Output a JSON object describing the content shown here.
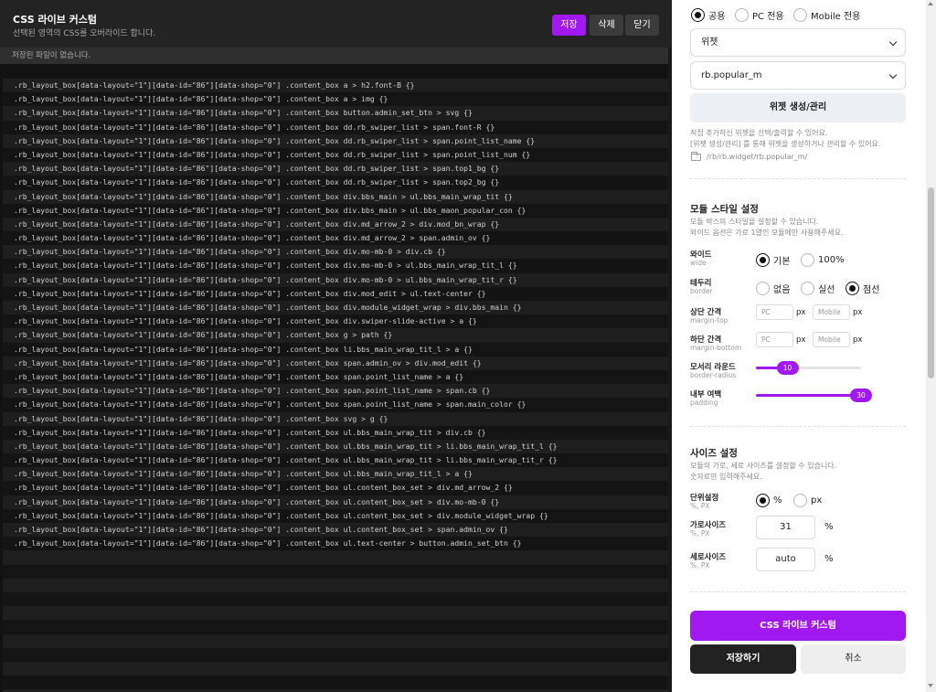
{
  "editor": {
    "title": "CSS 라이브 커스텀",
    "subtitle": "선택된 영역의 CSS를 오버라이드 합니다.",
    "buttons": {
      "save": "저장",
      "delete": "삭제",
      "close": "닫기"
    },
    "notice": "저장된 파일이 없습니다.",
    "lines": [
      ".rb_layout_box[data-layout=\"1\"][data-id=\"86\"][data-shop=\"0\"] .content_box a > h2.font-B {}",
      ".rb_layout_box[data-layout=\"1\"][data-id=\"86\"][data-shop=\"0\"] .content_box a > img {}",
      ".rb_layout_box[data-layout=\"1\"][data-id=\"86\"][data-shop=\"0\"] .content_box button.admin_set_btn > svg {}",
      ".rb_layout_box[data-layout=\"1\"][data-id=\"86\"][data-shop=\"0\"] .content_box dd.rb_swiper_list > span.font-R {}",
      ".rb_layout_box[data-layout=\"1\"][data-id=\"86\"][data-shop=\"0\"] .content_box dd.rb_swiper_list > span.point_list_name {}",
      ".rb_layout_box[data-layout=\"1\"][data-id=\"86\"][data-shop=\"0\"] .content_box dd.rb_swiper_list > span.point_list_num {}",
      ".rb_layout_box[data-layout=\"1\"][data-id=\"86\"][data-shop=\"0\"] .content_box dd.rb_swiper_list > span.top1_bg {}",
      ".rb_layout_box[data-layout=\"1\"][data-id=\"86\"][data-shop=\"0\"] .content_box dd.rb_swiper_list > span.top2_bg {}",
      ".rb_layout_box[data-layout=\"1\"][data-id=\"86\"][data-shop=\"0\"] .content_box div.bbs_main > ul.bbs_main_wrap_tit {}",
      ".rb_layout_box[data-layout=\"1\"][data-id=\"86\"][data-shop=\"0\"] .content_box div.bbs_main > ul.bbs_maon_popular_con {}",
      ".rb_layout_box[data-layout=\"1\"][data-id=\"86\"][data-shop=\"0\"] .content_box div.md_arrow_2 > div.mod_bn_wrap {}",
      ".rb_layout_box[data-layout=\"1\"][data-id=\"86\"][data-shop=\"0\"] .content_box div.md_arrow_2 > span.admin_ov {}",
      ".rb_layout_box[data-layout=\"1\"][data-id=\"86\"][data-shop=\"0\"] .content_box div.mo-mb-0 > div.cb {}",
      ".rb_layout_box[data-layout=\"1\"][data-id=\"86\"][data-shop=\"0\"] .content_box div.mo-mb-0 > ul.bbs_main_wrap_tit_l {}",
      ".rb_layout_box[data-layout=\"1\"][data-id=\"86\"][data-shop=\"0\"] .content_box div.mo-mb-0 > ul.bbs_main_wrap_tit_r {}",
      ".rb_layout_box[data-layout=\"1\"][data-id=\"86\"][data-shop=\"0\"] .content_box div.mod_edit > ul.text-center {}",
      ".rb_layout_box[data-layout=\"1\"][data-id=\"86\"][data-shop=\"0\"] .content_box div.module_widget_wrap > div.bbs_main {}",
      ".rb_layout_box[data-layout=\"1\"][data-id=\"86\"][data-shop=\"0\"] .content_box div.swiper-slide-active > a {}",
      ".rb_layout_box[data-layout=\"1\"][data-id=\"86\"][data-shop=\"0\"] .content_box g > path {}",
      ".rb_layout_box[data-layout=\"1\"][data-id=\"86\"][data-shop=\"0\"] .content_box li.bbs_main_wrap_tit_l > a {}",
      ".rb_layout_box[data-layout=\"1\"][data-id=\"86\"][data-shop=\"0\"] .content_box span.admin_ov > div.mod_edit {}",
      ".rb_layout_box[data-layout=\"1\"][data-id=\"86\"][data-shop=\"0\"] .content_box span.point_list_name > a {}",
      ".rb_layout_box[data-layout=\"1\"][data-id=\"86\"][data-shop=\"0\"] .content_box span.point_list_name > span.cb {}",
      ".rb_layout_box[data-layout=\"1\"][data-id=\"86\"][data-shop=\"0\"] .content_box span.point_list_name > span.main_color {}",
      ".rb_layout_box[data-layout=\"1\"][data-id=\"86\"][data-shop=\"0\"] .content_box svg > g {}",
      ".rb_layout_box[data-layout=\"1\"][data-id=\"86\"][data-shop=\"0\"] .content_box ul.bbs_main_wrap_tit > div.cb {}",
      ".rb_layout_box[data-layout=\"1\"][data-id=\"86\"][data-shop=\"0\"] .content_box ul.bbs_main_wrap_tit > li.bbs_main_wrap_tit_l {}",
      ".rb_layout_box[data-layout=\"1\"][data-id=\"86\"][data-shop=\"0\"] .content_box ul.bbs_main_wrap_tit > li.bbs_main_wrap_tit_r {}",
      ".rb_layout_box[data-layout=\"1\"][data-id=\"86\"][data-shop=\"0\"] .content_box ul.bbs_main_wrap_tit_l > a {}",
      ".rb_layout_box[data-layout=\"1\"][data-id=\"86\"][data-shop=\"0\"] .content_box ul.content_box_set > div.md_arrow_2 {}",
      ".rb_layout_box[data-layout=\"1\"][data-id=\"86\"][data-shop=\"0\"] .content_box ul.content_box_set > div.mo-mb-0 {}",
      ".rb_layout_box[data-layout=\"1\"][data-id=\"86\"][data-shop=\"0\"] .content_box ul.content_box_set > div.module_widget_wrap {}",
      ".rb_layout_box[data-layout=\"1\"][data-id=\"86\"][data-shop=\"0\"] .content_box ul.content_box_set > span.admin_ov {}",
      ".rb_layout_box[data-layout=\"1\"][data-id=\"86\"][data-shop=\"0\"] .content_box ul.text-center > button.admin_set_btn {}",
      "",
      "",
      "",
      "",
      "",
      "",
      "",
      "",
      "",
      "",
      ""
    ]
  },
  "panel": {
    "device_options": {
      "common": "공용",
      "pc": "PC 전용",
      "mobile": "Mobile 전용",
      "selected": "common"
    },
    "type_select": {
      "value": "위젯"
    },
    "widget_select": {
      "value": "rb.popular_m"
    },
    "widget_manage_button": "위젯 생성/관리",
    "help_lines": [
      "직접 추가하신 위젯을 선택/출력할 수 있어요.",
      "[위젯 생성/관리] 를 통해 위젯을 생성하거나 관리할 수 있어요."
    ],
    "widget_path": "/rb/rb.widget/rb.popular_m/",
    "module_style": {
      "title": "모듈 스타일 설정",
      "desc": [
        "모듈 박스의 스타일을 설정할 수 있습니다.",
        "와이드 옵션은 가로 1열인 모듈에만 사용해주세요."
      ],
      "wide": {
        "label": "와이드",
        "sub": "wide",
        "opt1": "기본",
        "opt2": "100%",
        "selected": "기본"
      },
      "border": {
        "label": "테두리",
        "sub": "border",
        "opt1": "없음",
        "opt2": "실선",
        "opt3": "점선",
        "selected": "점선"
      },
      "margin_top": {
        "label": "상단 간격",
        "sub": "margin-top",
        "pc_placeholder": "PC",
        "mobile_placeholder": "Mobile",
        "unit": "px"
      },
      "margin_bottom": {
        "label": "하단 간격",
        "sub": "margin-bottom",
        "pc_placeholder": "PC",
        "mobile_placeholder": "Mobile",
        "unit": "px"
      },
      "border_radius": {
        "label": "모서리 라운드",
        "sub": "border-radius",
        "value": "10",
        "fraction": 0.3
      },
      "padding": {
        "label": "내부 여백",
        "sub": "padding",
        "value": "30",
        "fraction": 1.0
      }
    },
    "size": {
      "title": "사이즈 설정",
      "desc": [
        "모듈의 가로, 세로 사이즈를 설정할 수 있습니다.",
        "숫자로만 입력해주세요."
      ],
      "unit": {
        "label": "단위설정",
        "sub": "%, PX",
        "opt1": "%",
        "opt2": "px",
        "selected": "%"
      },
      "width": {
        "label": "가로사이즈",
        "sub": "%, PX",
        "value": "31",
        "unit": "%"
      },
      "height": {
        "label": "세로사이즈",
        "sub": "%, PX",
        "value": "auto",
        "unit": "%"
      }
    },
    "buttons": {
      "live_custom": "CSS 라이브 커스텀",
      "save": "저장하기",
      "cancel": "취소"
    },
    "accent_color": "#a218f0"
  }
}
